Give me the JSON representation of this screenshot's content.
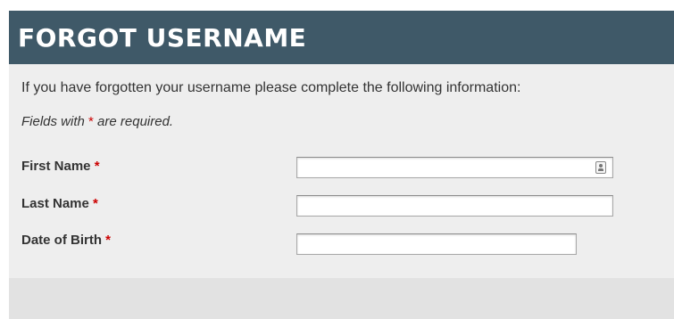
{
  "header": {
    "title": "FORGOT USERNAME"
  },
  "intro": {
    "text": "If you have forgotten your username please complete the following information:"
  },
  "required_note": {
    "prefix": "Fields with ",
    "asterisk": "*",
    "suffix": " are required."
  },
  "form": {
    "fields": [
      {
        "label": "First Name",
        "required_mark": "*",
        "value": "",
        "icon": "contact-card-icon"
      },
      {
        "label": "Last Name",
        "required_mark": "*",
        "value": ""
      },
      {
        "label": "Date of Birth",
        "required_mark": "*",
        "value": ""
      }
    ]
  },
  "colors": {
    "header_bg": "#3f5968",
    "panel_bg": "#eeeeee",
    "required": "#cc0000"
  }
}
